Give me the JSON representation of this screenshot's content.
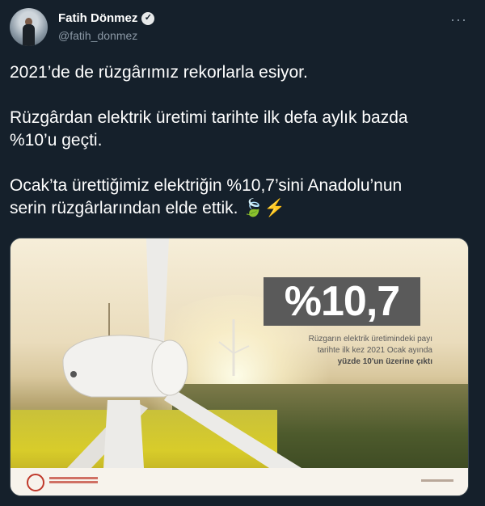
{
  "author": {
    "name": "Fatih Dönmez",
    "handle": "@fatih_donmez",
    "verified_icon": "verified-badge-icon"
  },
  "menu": {
    "icon": "more-options-icon",
    "label": "···"
  },
  "tweet": {
    "line1": "2021’de de rüzgârımız rekorlarla esiyor.",
    "line2": "Rüzgârdan elektrik üretimi tarihte ilk defa aylık bazda\n%10’u geçti.",
    "line3": "Ocak’ta ürettiğimiz elektriğin %10,7’sini Anadolu’nun\nserin rüzgârlarından elde ettik.",
    "emoji_leaf": "🍃",
    "emoji_bolt": "⚡"
  },
  "media": {
    "stat": "%10,7",
    "caption_line1": "Rüzgarın elektrik üretimindeki payı",
    "caption_line2": "tarihte ilk kez 2021 Ocak ayında",
    "caption_line3": "yüzde 10'un üzerine çıktı"
  },
  "colors": {
    "background": "#15202b",
    "text": "#ffffff",
    "secondary": "#8b98a5",
    "badge": "#5a5a5a"
  }
}
